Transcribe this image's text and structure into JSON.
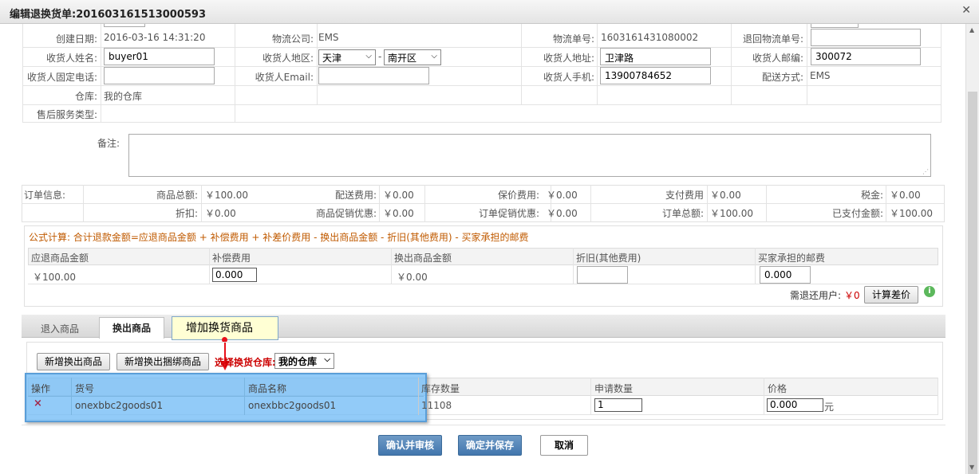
{
  "window": {
    "title": "编辑退换货单:201603161513000593"
  },
  "info": {
    "created_label": "创建日期:",
    "created_value": "2016-03-16 14:31:20",
    "logistics_company_label": "物流公司:",
    "logistics_company_value": "EMS",
    "tracking_label": "物流单号:",
    "tracking_value": "1603161431080002",
    "return_tracking_label": "退回物流单号:",
    "return_tracking_value": "",
    "receiver_name_label": "收货人姓名:",
    "receiver_name_value": "buyer01",
    "receiver_region_label": "收货人地区:",
    "province_value": "天津",
    "region_sep": "-",
    "district_value": "南开区",
    "receiver_address_label": "收货人地址:",
    "receiver_address_value": "卫津路",
    "receiver_zip_label": "收货人邮编:",
    "receiver_zip_value": "300072",
    "receiver_phone_label": "收货人固定电话:",
    "receiver_phone_value": "",
    "receiver_email_label": "收货人Email:",
    "receiver_email_value": "",
    "receiver_mobile_label": "收货人手机:",
    "receiver_mobile_value": "13900784652",
    "shipping_method_label": "配送方式:",
    "shipping_method_value": "EMS",
    "warehouse_label": "仓库:",
    "warehouse_value": "我的仓库",
    "service_type_label": "售后服务类型:",
    "service_type_value": ""
  },
  "remark": {
    "label": "备注:",
    "value": ""
  },
  "order": {
    "label": "订单信息:",
    "goods_total_label": "商品总额:",
    "goods_total_value": "￥100.00",
    "shipping_fee_label": "配送费用:",
    "shipping_fee_value": "￥0.00",
    "insurance_label": "保价费用:",
    "insurance_value": "￥0.00",
    "payment_fee_label": "支付费用",
    "payment_fee_value": "￥0.00",
    "tax_label": "税金:",
    "tax_value": "￥0.00",
    "discount_label": "折扣:",
    "discount_value": "￥0.00",
    "goods_promo_label": "商品促销优惠:",
    "goods_promo_value": "￥0.00",
    "order_promo_label": "订单促销优惠:",
    "order_promo_value": "￥0.00",
    "order_total_label": "订单总额:",
    "order_total_value": "￥100.00",
    "paid_label": "已支付金额:",
    "paid_value": "￥100.00"
  },
  "formula": {
    "text": "公式计算: 合计退款金额=应退商品金额 + 补偿费用 + 补差价费用 - 换出商品金额 - 折旧(其他费用) - 买家承担的邮费",
    "headers": [
      "应退商品金额",
      "补偿费用",
      "换出商品金额",
      "折旧(其他费用)",
      "买家承担的邮费"
    ],
    "refund_goods_value": "￥100.00",
    "compensation_value": "0.000",
    "exchange_goods_value": "￥0.00",
    "depreciation_value": "",
    "buyer_postage_value": "0.000",
    "refund_user_label": "需退还用户:",
    "refund_user_value": "￥0",
    "calc_button": "计算差价"
  },
  "tabs": {
    "return_goods": "退入商品",
    "exchange_goods": "换出商品"
  },
  "tooltip": {
    "text": "增加换货商品"
  },
  "exchange": {
    "add_button": "新增换出商品",
    "add_bundle_button": "新增换出捆绑商品",
    "warehouse_select_label": "选择换货仓库:",
    "warehouse_select_value": "我的仓库",
    "headers": {
      "op": "操作",
      "sku": "货号",
      "name": "商品名称",
      "stock": "库存数量",
      "qty": "申请数量",
      "price": "价格"
    },
    "row": {
      "delete_icon": "×",
      "sku": "onexbbc2goods01",
      "name": "onexbbc2goods01",
      "stock": "11108",
      "qty": "1",
      "price": "0.000",
      "unit": "元"
    }
  },
  "footer": {
    "confirm_audit": "确认并审核",
    "confirm_save": "确定并保存",
    "cancel": "取消"
  },
  "colors": {
    "accent": "#4276ad",
    "highlight": "#8ec9f5",
    "danger": "#cc0000",
    "formula_text": "#c05a00",
    "tooltip_bg": "#ffffd4"
  }
}
